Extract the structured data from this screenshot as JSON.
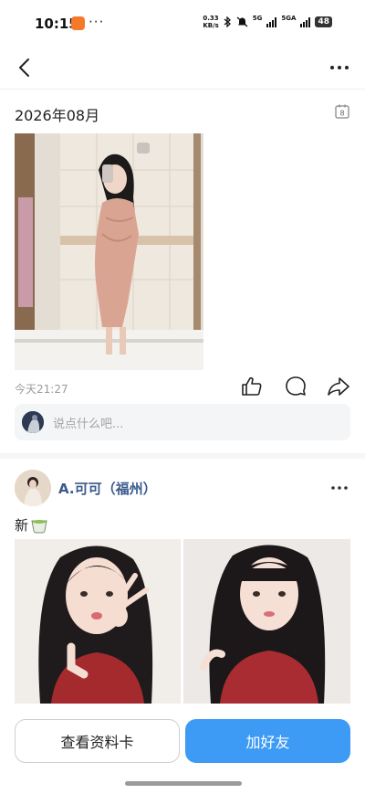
{
  "status_bar": {
    "time": "10:15",
    "more_dots": "···",
    "net_speed_value": "0.33",
    "net_speed_unit": "KB/s",
    "signal_1_label": "5G",
    "signal_2_label": "5GA",
    "battery": "48"
  },
  "header": {
    "back_icon": "chevron-left-icon",
    "more_icon": "more-horizontal-icon"
  },
  "moment": {
    "date_title": "2026年08月",
    "calendar_day": "8",
    "time": "今天21:27",
    "comment_placeholder": "说点什么吧..."
  },
  "friend_post": {
    "name": "A.可可（福州）",
    "text": "新"
  },
  "bottom_bar": {
    "profile_button": "查看资料卡",
    "add_friend_button": "加好友"
  },
  "colors": {
    "accent": "#3d9af5",
    "name_link": "#3a5a8c",
    "muted_text": "#9a9a9a"
  }
}
